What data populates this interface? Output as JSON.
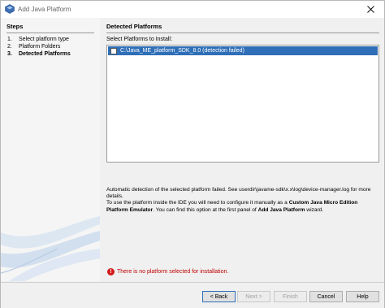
{
  "window": {
    "title": "Add Java Platform"
  },
  "steps": {
    "header": "Steps",
    "items": [
      {
        "num": "1.",
        "label": "Select platform type"
      },
      {
        "num": "2.",
        "label": "Platform Folders"
      },
      {
        "num": "3.",
        "label": "Detected Platforms"
      }
    ]
  },
  "content": {
    "header": "Detected Platforms",
    "select_label": "Select Platforms to Install:",
    "platforms": [
      {
        "label": "C:\\Java_ME_platform_SDK_8.0 (detection failed)",
        "checked": false
      }
    ],
    "info_line1": "Automatic detection of the selected platform failed. See userdir\\javame-sdk\\x.x\\log\\device-manager.log for more details.",
    "info_line2_a": "To use the platform inside the IDE you will need to configure it manually as a ",
    "info_line2_b": "Custom Java Micro Edition Platform Emulator",
    "info_line2_c": ". You can find this option at the first panel of ",
    "info_line2_d": "Add Java Platform",
    "info_line2_e": " wizard.",
    "error": "There is no platform selected for installation."
  },
  "buttons": {
    "back": "< Back",
    "next": "Next >",
    "finish": "Finish",
    "cancel": "Cancel",
    "help": "Help"
  },
  "colors": {
    "selection": "#2f6fb7",
    "error": "#c00000"
  }
}
